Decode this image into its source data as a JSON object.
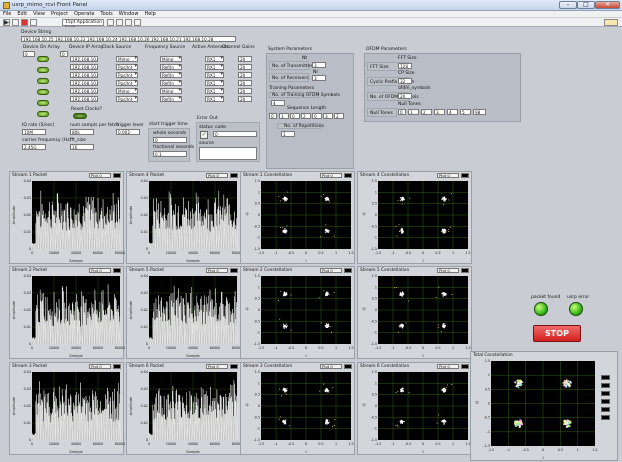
{
  "window": {
    "title": "usrp_mimo_rcvi Front Panel",
    "min": "–",
    "max": "□",
    "close": "✕"
  },
  "menu": [
    "File",
    "Edit",
    "View",
    "Project",
    "Operate",
    "Tools",
    "Window",
    "Help"
  ],
  "toolbar": {
    "font": "15pt Application Font"
  },
  "device_string": {
    "label": "Device String",
    "value": "192.168.10.25  192.168.10.22  192.168.10.24  192.168.10.26  192.168.10.21  192.168.10.28"
  },
  "device_on_array": {
    "label": "Device On Array",
    "index": "0"
  },
  "device_ip_array": {
    "label": "Device IP Array",
    "index": "0",
    "items": [
      "192.168.10.25",
      "192.168.10.22",
      "192.168.10.24",
      "192.168.10.26",
      "192.168.10.21",
      "192.168.10.28"
    ]
  },
  "clock_source": {
    "label": "Clock Source",
    "items": [
      "Mimo",
      "Pps/Int",
      "Pps/Int",
      "Pps/Int",
      "Mimo",
      "Pps/Int"
    ]
  },
  "frequency_source": {
    "label": "Frequency Source",
    "items": [
      "Mimo",
      "Ref/In",
      "Ref/In",
      "Ref/In",
      "Mimo",
      "Ref/In"
    ]
  },
  "active_antennas": {
    "label": "Active Antennas",
    "items": [
      "RX1",
      "RX1",
      "RX1",
      "RX1",
      "RX1",
      "RX1"
    ]
  },
  "channel_gains": {
    "label": "Channel Gains",
    "items": [
      "20",
      "20",
      "20",
      "20",
      "20",
      "20"
    ]
  },
  "reset_clocks": {
    "label": "Reset Clocks?"
  },
  "iq_rate": {
    "label": "IQ rate (S/sec)",
    "value": "10M"
  },
  "num_samps": {
    "label": "num sampls per fetch",
    "value": "80k"
  },
  "trigger_level": {
    "label": "trigger level",
    "value": "0.002"
  },
  "carrier_freq": {
    "label": "carrier frequency (Hz)",
    "value": "2.45G"
  },
  "fft_size_small": {
    "label": "fft_size",
    "value": "16"
  },
  "start_trigger": {
    "label": "start trigger time",
    "whole_label": "whole seconds",
    "whole_value": "0",
    "frac_label": "fractional seconds",
    "frac_value": "0.1"
  },
  "error_out": {
    "label": "Error Out",
    "status_label": "status",
    "code_label": "code",
    "code_value": "0",
    "source_label": "source"
  },
  "system_params": {
    "title": "System Parameters",
    "n_tx_label": "No. of Transmitters",
    "n_tx_value": "3",
    "n_rx_label": "No. of Receivers",
    "n_rx_value": "3",
    "nt_label": "Nt",
    "nr_label": "Nr",
    "training_title": "Training Parameters",
    "n_train_label": "No. of Training OFDM Symbols",
    "n_train_value": "4",
    "seq_len_label": "Sequence Length",
    "seq_len_values": [
      "0",
      "1",
      "0",
      "2",
      "0",
      "3",
      "2"
    ],
    "n_rep_label": "No. of Repetitions",
    "n_rep_value": "1"
  },
  "ofdm_params": {
    "title": "OFDM Parameters",
    "fft_size_label": "FFT Size",
    "fft_size_value": "128",
    "cp_label": "Cyclic Prefix Length",
    "cp_size_label": "CP Size",
    "cp_value": "32",
    "n_sym_label": "No. of OFDM Symbols",
    "n_sym_small_label": "ofdm_symbols",
    "n_sym_value": "20",
    "null_tones_label": "Null Tones",
    "null_tones_small_label": "Null Tones",
    "null_tones_values": [
      "0",
      "1",
      "2",
      "3",
      "4",
      "5",
      "98"
    ]
  },
  "packets": [
    {
      "title": "Stream 1 Packet",
      "legend": "Plot 0"
    },
    {
      "title": "Stream 4 Packet",
      "legend": "Plot 0"
    },
    {
      "title": "Stream 2 Packet",
      "legend": "Plot 0"
    },
    {
      "title": "Stream 5 Packet",
      "legend": "Plot 0"
    },
    {
      "title": "Stream 3 Packet",
      "legend": "Plot 0"
    },
    {
      "title": "Stream 6 Packet",
      "legend": "Plot 0"
    }
  ],
  "constellations": [
    {
      "title": "Stream 1 Constellation",
      "legend": "Plot 0"
    },
    {
      "title": "Stream 4 Constellation",
      "legend": "Plot 0"
    },
    {
      "title": "Stream 2 Constellation",
      "legend": "Plot 0"
    },
    {
      "title": "Stream 5 Constellation",
      "legend": "Plot 0"
    },
    {
      "title": "Stream 3 Constellation",
      "legend": "Plot 0"
    },
    {
      "title": "Stream 6 Constellation",
      "legend": "Plot 0"
    }
  ],
  "packet_axes": {
    "x_label": "Sample",
    "y_label": "Amplitude",
    "x_ticks": [
      "0",
      "20000",
      "40000",
      "60000",
      "80000"
    ],
    "y_ticks": [
      "0",
      "0.01",
      "0.02",
      "0.03",
      "0.04"
    ]
  },
  "const_axes": {
    "x_label": "I",
    "y_label": "Q",
    "ticks": [
      "-1.5",
      "-1",
      "-0.5",
      "0",
      "0.5",
      "1",
      "1.5"
    ]
  },
  "total_constellation": {
    "title": "Total Constellation",
    "legend": [
      "Plot 0",
      "Plot 1",
      "Plot 2",
      "Plot 3",
      "Plot 4",
      "Plot 5"
    ],
    "ticks": [
      "-1.5",
      "-1",
      "-0.5",
      "0",
      "0.5",
      "1",
      "1.5"
    ],
    "x_label": "I",
    "y_label": "Q"
  },
  "indicators": {
    "packet_found": "packet found",
    "usrp_error": "usrp error",
    "stop": "STOP"
  },
  "colors": {
    "panel": "#c9cdd3",
    "plot_bg": "#000000",
    "trace": "#ffffff",
    "grid": "#3f7a1d",
    "led": "#37b81a",
    "stop": "#d22020"
  }
}
